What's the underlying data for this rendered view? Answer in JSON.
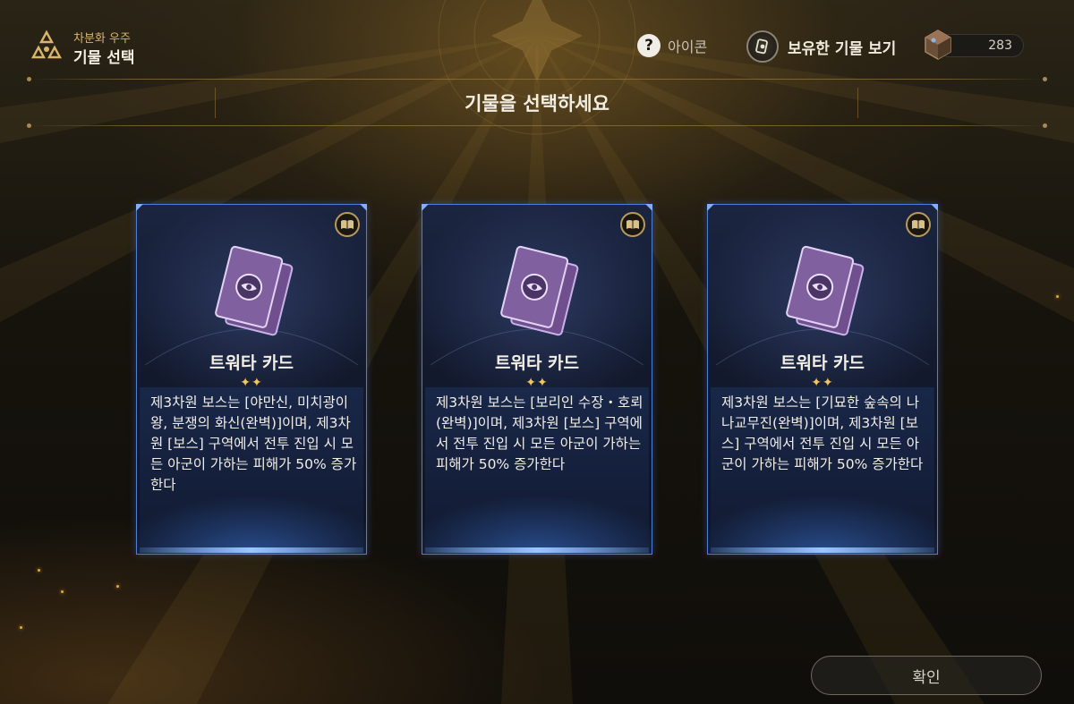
{
  "header": {
    "breadcrumb_sub": "차분화 우주",
    "title": "기물 선택",
    "help_label": "아이콘",
    "owned_label": "보유한 기물 보기",
    "currency_value": "283"
  },
  "page_heading": "기물을 선택하세요",
  "cards": [
    {
      "name": "트워타 카드",
      "stars": "✦✦",
      "description": "제3차원 보스는 [야만신, 미치광이 왕, 분쟁의 화신(완벽)]이며, 제3차원 [보스] 구역에서 전투 진입 시 모든 아군이 가하는 피해가 50% 증가한다"
    },
    {
      "name": "트워타 카드",
      "stars": "✦✦",
      "description": "제3차원 보스는 [보리인 수장・호뢰(완벽)]이며, 제3차원 [보스] 구역에서 전투 진입 시 모든 아군이 가하는 피해가 50% 증가한다"
    },
    {
      "name": "트워타 카드",
      "stars": "✦✦",
      "description": "제3차원 보스는 [기묘한 숲속의 나나교무진(완벽)]이며, 제3차원 [보스] 구역에서 전투 진입 시 모든 아군이 가하는 피해가 50% 증가한다"
    }
  ],
  "confirm_label": "확인",
  "colors": {
    "card_border": "#4d7fd6",
    "accent_gold": "#d9b46a",
    "star": "#f2c65c"
  },
  "icons": [
    "logo-triad-icon",
    "help-icon",
    "relic-icon",
    "gem-icon",
    "book-icon",
    "card-stack-icon"
  ]
}
